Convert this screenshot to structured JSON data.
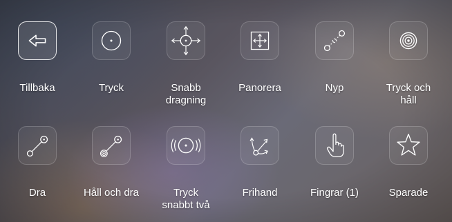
{
  "gesture_menu": {
    "row1": [
      {
        "label_line1": "Tillbaka",
        "label_line2": "",
        "icon": "back-arrow-icon",
        "selected": true
      },
      {
        "label_line1": "Tryck",
        "label_line2": "",
        "icon": "tap-icon"
      },
      {
        "label_line1": "Snabb",
        "label_line2": "dragning",
        "icon": "flick-icon"
      },
      {
        "label_line1": "Panorera",
        "label_line2": "",
        "icon": "pan-icon"
      },
      {
        "label_line1": "Nyp",
        "label_line2": "",
        "icon": "pinch-icon"
      },
      {
        "label_line1": "Tryck och",
        "label_line2": "håll",
        "icon": "press-hold-icon"
      }
    ],
    "row2": [
      {
        "label_line1": "Dra",
        "label_line2": "",
        "icon": "drag-icon"
      },
      {
        "label_line1": "Håll och dra",
        "label_line2": "",
        "icon": "hold-drag-icon"
      },
      {
        "label_line1": "Tryck",
        "label_line2": "snabbt två",
        "icon": "double-tap-icon"
      },
      {
        "label_line1": "Frihand",
        "label_line2": "",
        "icon": "freehand-icon"
      },
      {
        "label_line1": "Fingrar (1)",
        "label_line2": "",
        "icon": "finger-icon"
      },
      {
        "label_line1": "Sparade",
        "label_line2": "",
        "icon": "star-icon"
      }
    ]
  }
}
